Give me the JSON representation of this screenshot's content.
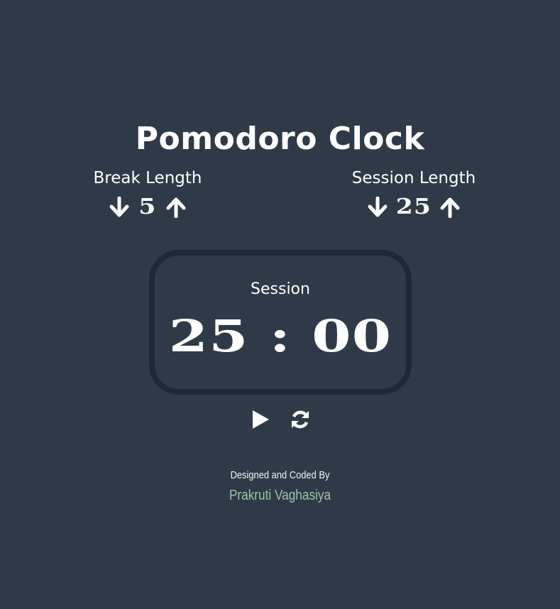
{
  "app": {
    "title": "Pomodoro Clock"
  },
  "break_control": {
    "label": "Break Length",
    "value": "5",
    "decrement_icon": "arrow-down-icon",
    "increment_icon": "arrow-up-icon"
  },
  "session_control": {
    "label": "Session Length",
    "value": "25",
    "decrement_icon": "arrow-down-icon",
    "increment_icon": "arrow-up-icon"
  },
  "timer": {
    "label": "Session",
    "display": "25 : 00"
  },
  "playback": {
    "play_icon": "play-icon",
    "reset_icon": "refresh-icon"
  },
  "footer": {
    "credit_line": "Designed and Coded By",
    "author": "Prakruti Vaghasiya"
  },
  "colors": {
    "background": "#2e3a48",
    "timer_border": "#1e2935",
    "text": "#ffffff",
    "author": "#9ec3a3"
  }
}
